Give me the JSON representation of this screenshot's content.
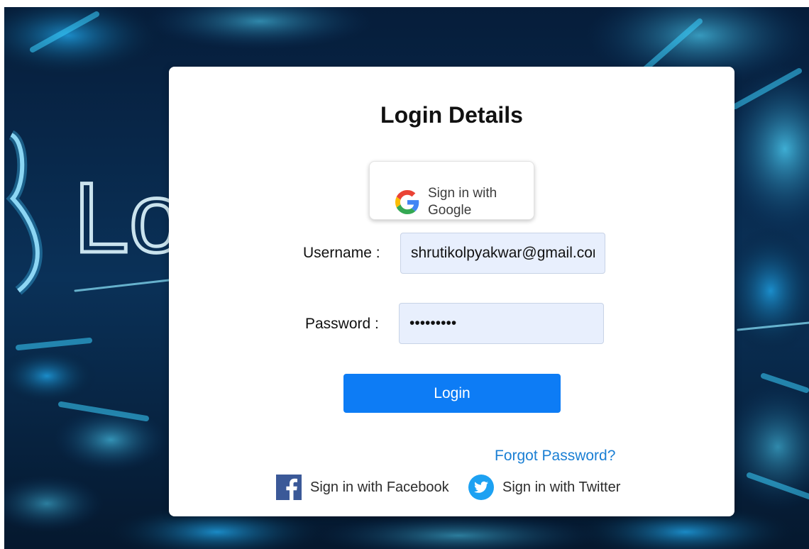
{
  "login": {
    "title": "Login Details",
    "google": {
      "label": "Sign in with Google"
    },
    "username": {
      "label": "Username :",
      "value": "shrutikolpyakwar@gmail.com"
    },
    "password": {
      "label": "Password :",
      "value": "shrutikol"
    },
    "login_button": "Login",
    "forgot_password": "Forgot Password?",
    "facebook": {
      "label": "Sign in with Facebook"
    },
    "twitter": {
      "label": "Sign in with Twitter"
    }
  },
  "background": {
    "partial_text": "Lo"
  },
  "colors": {
    "primary_button": "#0d7cf5",
    "link": "#1a7fd4",
    "input_fill": "#e8effd",
    "facebook": "#3b5998",
    "twitter": "#1da1f2",
    "background_dark": "#04162b",
    "background_glow": "#22c8ff"
  },
  "icons": {
    "google": "google-g-icon",
    "facebook": "facebook-f-icon",
    "twitter": "twitter-bird-icon"
  }
}
